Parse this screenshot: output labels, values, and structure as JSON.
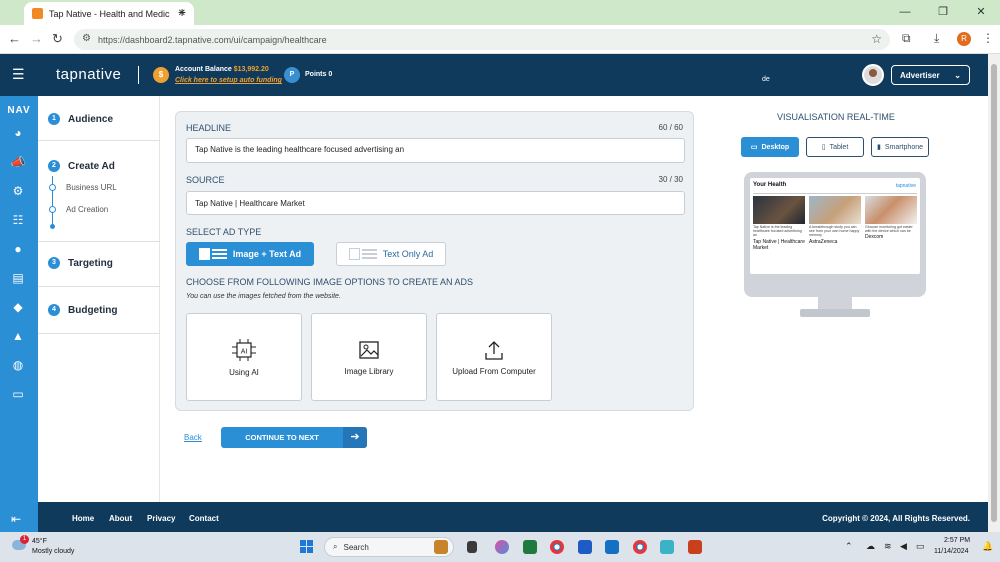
{
  "browser": {
    "tab_title": "Tap Native - Health and Medic",
    "url": "https://dashboard2.tapnative.com/ui/campaign/healthcare",
    "profile_initial": "R"
  },
  "header": {
    "logo": "tapnative",
    "balance_label": "Account Balance",
    "balance_value": "$13,992.20",
    "balance_link": "Click here to setup auto funding",
    "points_badge": "P",
    "points_label": "Points 0",
    "coin_symbol": "$",
    "user_name": "de",
    "role_select": "Advertiser"
  },
  "nav": {
    "label": "NAV"
  },
  "steps": {
    "items": [
      {
        "num": "1",
        "label": "Audience"
      },
      {
        "num": "2",
        "label": "Create Ad"
      },
      {
        "num": "3",
        "label": "Targeting"
      },
      {
        "num": "4",
        "label": "Budgeting"
      }
    ],
    "substeps": [
      "Business URL",
      "Ad Creation"
    ]
  },
  "form": {
    "headline_label": "HEADLINE",
    "headline_count": "60 / 60",
    "headline_value": "Tap Native is the leading healthcare focused advertising an",
    "source_label": "SOURCE",
    "source_count": "30 / 30",
    "source_value": "Tap Native | Healthcare Market",
    "ad_type_label": "SELECT AD TYPE",
    "ad_type_options": [
      "Image + Text Ad",
      "Text Only Ad"
    ],
    "ad_type_selected": "Image + Text Ad",
    "image_options_label": "CHOOSE FROM FOLLOWING IMAGE OPTIONS TO CREATE AN ADS",
    "image_options_note": "You can use the images fetched from the website.",
    "image_options": [
      "Using AI",
      "Image Library",
      "Upload From Computer"
    ],
    "ai_icon_text": "AI",
    "back_label": "Back",
    "continue_label": "CONTINUE TO NEXT"
  },
  "preview": {
    "title": "VISUALISATION REAL-TIME",
    "devices": [
      "Desktop",
      "Tablet",
      "Smartphone"
    ],
    "selected_device": "Desktop",
    "screen_title": "Your Health",
    "screen_logo": "tapnative",
    "ads": [
      {
        "text": "Tap Native is the leading healthcare focused advertising an",
        "source": "Tap Native | Healthcare Market"
      },
      {
        "text": "A breakthrough study you can see from your own home happy memory",
        "source": "AstraZeneca"
      },
      {
        "text": "Glucose monitoring got easier with the device which can be",
        "source": "Dexcom"
      }
    ]
  },
  "footer": {
    "links": [
      "Home",
      "About",
      "Privacy",
      "Contact"
    ],
    "copyright": "Copyright © 2024, All Rights Reserved."
  },
  "taskbar": {
    "weather_badge": "1",
    "weather_temp": "45°F",
    "weather_desc": "Mostly cloudy",
    "search_placeholder": "Search",
    "time": "2:57 PM",
    "date": "11/14/2024"
  },
  "colors": {
    "primary": "#2b8fd6",
    "header": "#0f3a5c",
    "accent": "#f0a030"
  }
}
